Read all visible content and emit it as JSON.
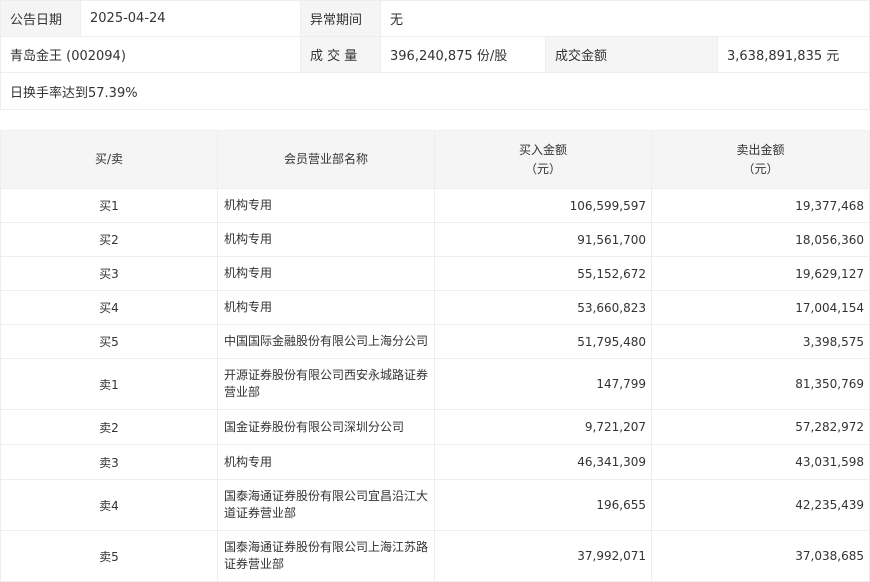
{
  "info": {
    "date_label": "公告日期",
    "date_value": "2025-04-24",
    "period_label": "异常期间",
    "period_value": "无",
    "stock_name": "青岛金王 (002094)",
    "volume_label": "成 交 量",
    "volume_value": "396,240,875 份/股",
    "amount_label": "成交金额",
    "amount_value": "3,638,891,835 元",
    "reason": "日换手率达到57.39%"
  },
  "table": {
    "headers": {
      "side": "买/卖",
      "broker": "会员营业部名称",
      "buy": "买入金额",
      "buy_unit": "（元）",
      "sell": "卖出金额",
      "sell_unit": "（元）"
    },
    "rows": [
      {
        "side": "买1",
        "broker": "机构专用",
        "buy": "106,599,597",
        "sell": "19,377,468"
      },
      {
        "side": "买2",
        "broker": "机构专用",
        "buy": "91,561,700",
        "sell": "18,056,360"
      },
      {
        "side": "买3",
        "broker": "机构专用",
        "buy": "55,152,672",
        "sell": "19,629,127"
      },
      {
        "side": "买4",
        "broker": "机构专用",
        "buy": "53,660,823",
        "sell": "17,004,154"
      },
      {
        "side": "买5",
        "broker": "中国国际金融股份有限公司上海分公司",
        "buy": "51,795,480",
        "sell": "3,398,575"
      },
      {
        "side": "卖1",
        "broker": "开源证券股份有限公司西安永城路证券营业部",
        "buy": "147,799",
        "sell": "81,350,769"
      },
      {
        "side": "卖2",
        "broker": "国金证券股份有限公司深圳分公司",
        "buy": "9,721,207",
        "sell": "57,282,972"
      },
      {
        "side": "卖3",
        "broker": "机构专用",
        "buy": "46,341,309",
        "sell": "43,031,598"
      },
      {
        "side": "卖4",
        "broker": "国泰海通证券股份有限公司宜昌沿江大道证券营业部",
        "buy": "196,655",
        "sell": "42,235,439"
      },
      {
        "side": "卖5",
        "broker": "国泰海通证券股份有限公司上海江苏路证券营业部",
        "buy": "37,992,071",
        "sell": "37,038,685"
      }
    ]
  }
}
